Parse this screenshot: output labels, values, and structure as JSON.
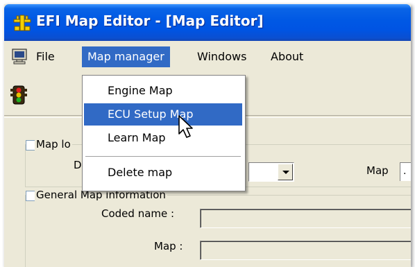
{
  "window": {
    "title": "EFI Map Editor - [Map Editor]"
  },
  "menubar": {
    "items": [
      {
        "label": "File"
      },
      {
        "label": "Map manager"
      },
      {
        "label": "Windows"
      },
      {
        "label": "About"
      }
    ],
    "active_item": "Map manager"
  },
  "dropdown": {
    "items": [
      {
        "label": "Engine Map"
      },
      {
        "label": "ECU Setup Map"
      },
      {
        "label": "Learn Map"
      },
      {
        "label": "Delete map"
      }
    ],
    "hovered_item": "ECU Setup Map"
  },
  "content": {
    "group1_label": "Map lo",
    "group1_field_label": "D",
    "map_label": "Map",
    "map_value": ".",
    "group2_label": "General Map information",
    "coded_name_label": "Coded name :",
    "map_field_label": "Map :"
  },
  "icons": {
    "title": "efi-app-icon",
    "menu": "computer-icon",
    "toolbar": "traffic-light-icon"
  },
  "colors": {
    "titlebar": "#0054e3",
    "highlight": "#316ac5",
    "window_bg": "#ece9d8"
  }
}
